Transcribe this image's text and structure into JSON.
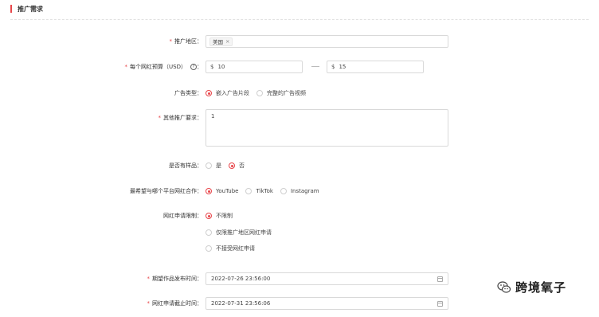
{
  "section": {
    "title": "推广需求"
  },
  "region": {
    "label": "推广地区：",
    "tags": [
      "美国"
    ]
  },
  "budget": {
    "label": "每个网红预算（USD）",
    "min_prefix": "$",
    "min_value": "10",
    "max_prefix": "$",
    "max_value": "15",
    "help_glyph": "?",
    "colon": "："
  },
  "ad_type": {
    "label": "广告类型：",
    "options": [
      "嵌入广告片段",
      "完整的广告视频"
    ],
    "selected": 0
  },
  "other_req": {
    "label": "其他推广要求：",
    "value": "1"
  },
  "samples": {
    "label": "是否有样品：",
    "options": [
      "是",
      "否"
    ],
    "selected": 1
  },
  "platform": {
    "label": "最希望与哪个平台网红合作：",
    "options": [
      "YouTube",
      "TikTok",
      "Instagram"
    ],
    "selected": 0
  },
  "restriction": {
    "label": "网红申请限制：",
    "options": [
      "不限制",
      "仅限推广地区网红申请",
      "不接受网红申请"
    ],
    "selected": 0
  },
  "publish_time": {
    "label": "期望作品发布时间：",
    "value": "2022-07-26 23:56:00"
  },
  "apply_deadline": {
    "label": "网红申请截止时间：",
    "value": "2022-07-31 23:56:06"
  },
  "watermark": {
    "text": "跨境氧子"
  }
}
